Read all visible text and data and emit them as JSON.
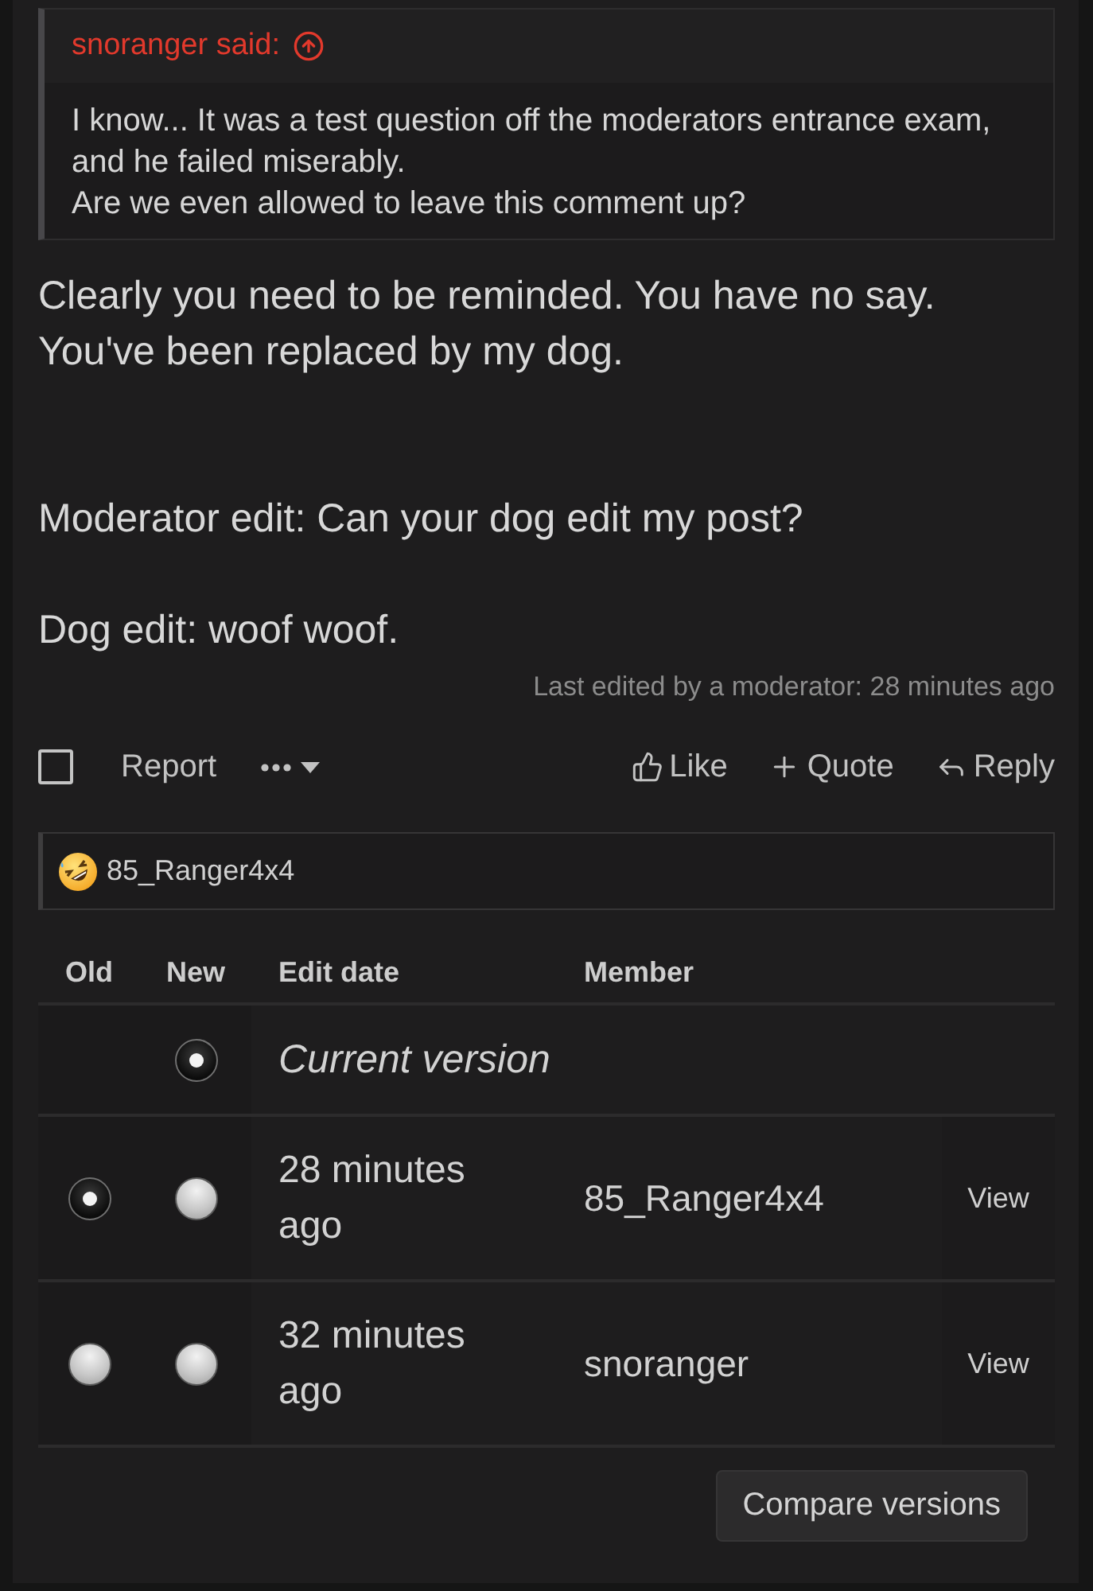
{
  "quote": {
    "header": "snoranger said:",
    "text": "I know... It was a test question off the moderators entrance exam, and he failed miserably.\nAre we even allowed to leave this comment up?"
  },
  "message": {
    "text": "Clearly you need to be reminded. You have no say.\nYou've been replaced by my dog.\n\n\nModerator edit: Can your dog edit my post?\n\nDog edit: woof woof.",
    "edit_note": "Last edited by a moderator: 28 minutes ago"
  },
  "actions": {
    "select_checked": false,
    "report": "Report",
    "buttons": [
      {
        "kind": "like",
        "label": "Like"
      },
      {
        "kind": "quote",
        "label": "Quote"
      },
      {
        "kind": "reply",
        "label": "Reply"
      }
    ]
  },
  "reactions": {
    "users": "85_Ranger4x4"
  },
  "history": {
    "columns": [
      "Old",
      "New",
      "Edit date",
      "Member"
    ],
    "rows": [
      {
        "kind": "current",
        "label": "Current version",
        "new_radio": {
          "selected": true
        }
      },
      {
        "kind": "version",
        "date": "28 minutes ago",
        "member": "85_Ranger4x4",
        "action": "View",
        "old_radio": {
          "selected": true
        },
        "new_radio": {
          "selected": false
        }
      },
      {
        "kind": "version",
        "date": "32 minutes ago",
        "member": "snoranger",
        "action": "View",
        "old_radio": {
          "selected": false
        },
        "new_radio": {
          "selected": false
        }
      }
    ],
    "compare_button": "Compare versions"
  }
}
